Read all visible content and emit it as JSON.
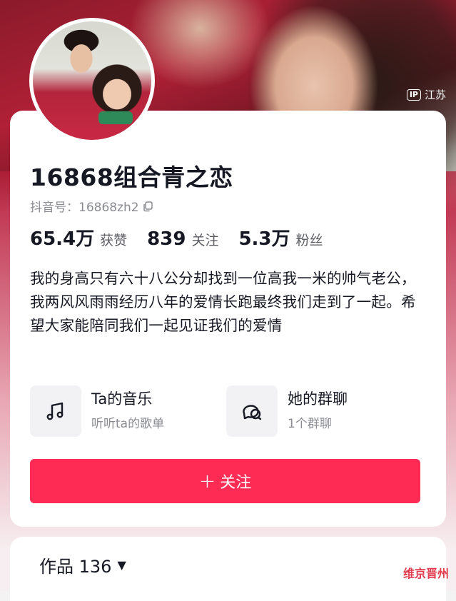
{
  "cover": {
    "ip_label": "IP",
    "ip_location": "江苏"
  },
  "profile": {
    "name": "16868组合青之恋",
    "douyin_id": "抖音号：16868zh2",
    "stats": [
      {
        "value": "65.4万",
        "label": "获赞"
      },
      {
        "value": "839",
        "label": "关注"
      },
      {
        "value": "5.3万",
        "label": "粉丝"
      }
    ],
    "bio": "我的身高只有六十八公分却找到一位高我一米的帅气老公，我两风风雨雨经历八年的爱情长跑最终我们走到了一起。希望大家能陪同我们一起见证我们的爱情"
  },
  "tiles": [
    {
      "icon": "music-note-icon",
      "title": "Ta的音乐",
      "subtitle": "听听ta的歌单"
    },
    {
      "icon": "group-chat-icon",
      "title": "她的群聊",
      "subtitle": "1个群聊"
    }
  ],
  "actions": {
    "follow_plus": "+",
    "follow_label": "关注"
  },
  "works": {
    "label": "作品 136",
    "caret": "▼"
  },
  "watermark": "维京晋州",
  "colors": {
    "accent": "#fe2c55",
    "text": "#161823",
    "muted": "#8a8b91"
  }
}
